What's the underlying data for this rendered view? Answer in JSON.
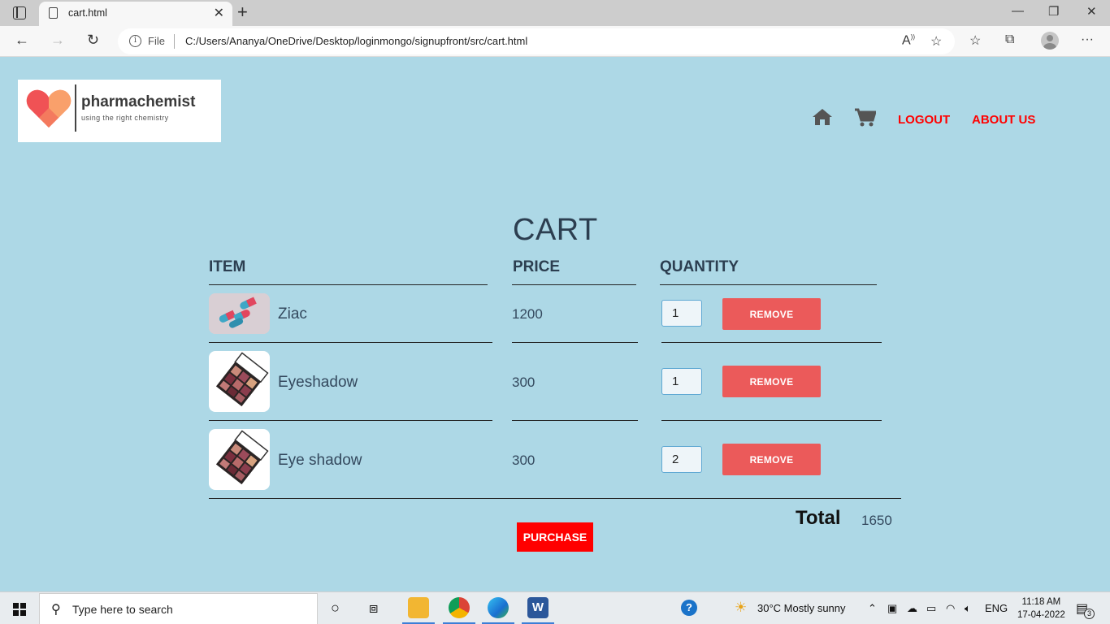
{
  "browser": {
    "tab_title": "cart.html",
    "url_scheme_label": "File",
    "url": "C:/Users/Ananya/OneDrive/Desktop/loginmongo/signupfront/src/cart.html"
  },
  "header": {
    "logo_name": "pharmachemist",
    "logo_tagline": "using the right chemistry",
    "nav": {
      "home_icon": "home-icon",
      "cart_icon": "cart-icon",
      "logout": "LOGOUT",
      "about": "ABOUT US"
    }
  },
  "cart": {
    "title": "CART",
    "columns": {
      "item": "ITEM",
      "price": "PRICE",
      "quantity": "QUANTITY"
    },
    "items": [
      {
        "name": "Ziac",
        "price": "1200",
        "quantity": "1",
        "remove_label": "REMOVE",
        "image": "pills"
      },
      {
        "name": "Eyeshadow",
        "price": "300",
        "quantity": "1",
        "remove_label": "REMOVE",
        "image": "eyeshadow-palette"
      },
      {
        "name": "Eye shadow",
        "price": "300",
        "quantity": "2",
        "remove_label": "REMOVE",
        "image": "eyeshadow-palette"
      }
    ],
    "total_label": "Total",
    "total_value": "1650",
    "purchase_label": "PURCHASE"
  },
  "taskbar": {
    "search_placeholder": "Type here to search",
    "weather": "30°C  Mostly sunny",
    "language": "ENG",
    "time": "11:18 AM",
    "date": "17-04-2022",
    "notification_count": "3"
  },
  "colors": {
    "page_bg": "#add8e6",
    "nav_link": "#ff0000",
    "remove_button": "#eb5a5a",
    "purchase_button": "#ff0000"
  }
}
